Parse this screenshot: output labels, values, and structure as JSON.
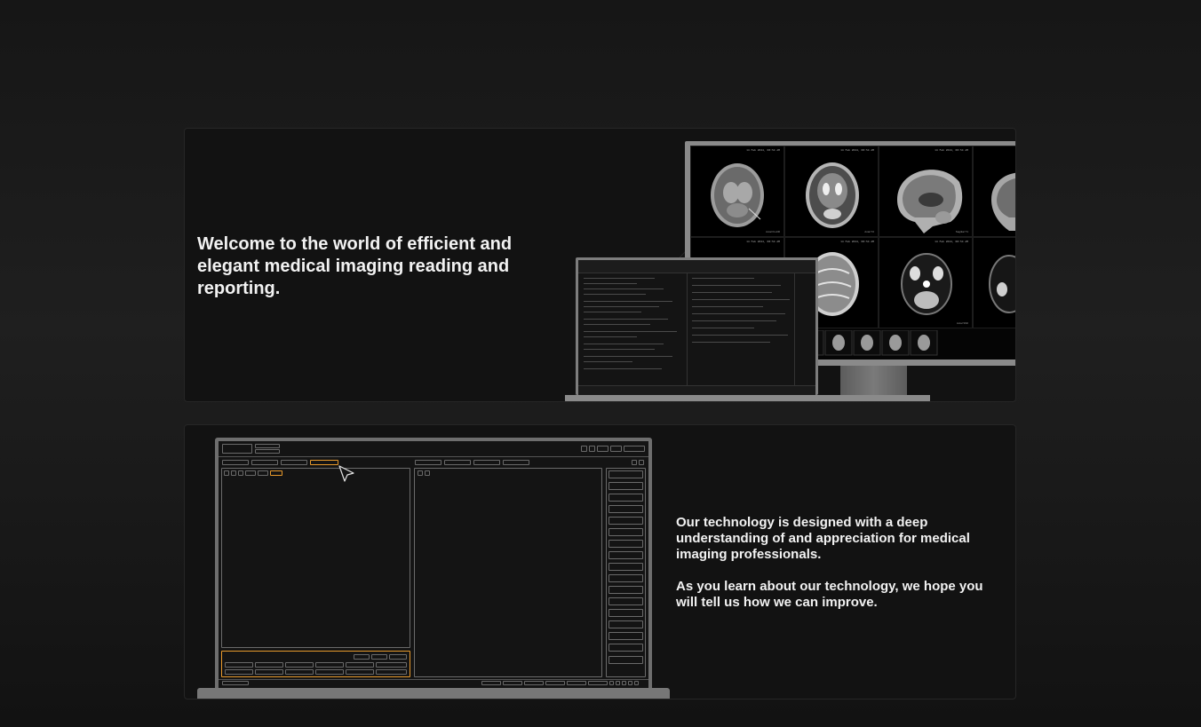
{
  "hero": {
    "headline": "Welcome to the world of efficient and elegant medical imaging reading and reporting.",
    "monitor": {
      "scans": [
        {
          "date": "14 Feb 2024, 08:54 AM",
          "caption": "Axial FLAIR"
        },
        {
          "date": "14 Feb 2024, 08:54 AM",
          "caption": "Axial T2"
        },
        {
          "date": "14 Feb 2024, 08:54 AM",
          "caption": "Sagittal T1"
        },
        {
          "date": "",
          "caption": ""
        },
        {
          "date": "14 Feb 2024, 08:54 AM",
          "caption": ""
        },
        {
          "date": "14 Feb 2024, 08:54 AM",
          "caption": "Axial SWI"
        },
        {
          "date": "",
          "caption": ""
        },
        {
          "date": "",
          "caption": ""
        }
      ]
    }
  },
  "technology": {
    "paragraph_1": "Our technology is designed with a deep understanding of and appreciation for medical imaging professionals.",
    "paragraph_2": "As you learn about our technology, we hope you will tell us how we can improve."
  },
  "colors": {
    "background": "#1a1a1a",
    "card": "#121212",
    "accent": "#e89a2c",
    "text": "#f2f2f2"
  }
}
